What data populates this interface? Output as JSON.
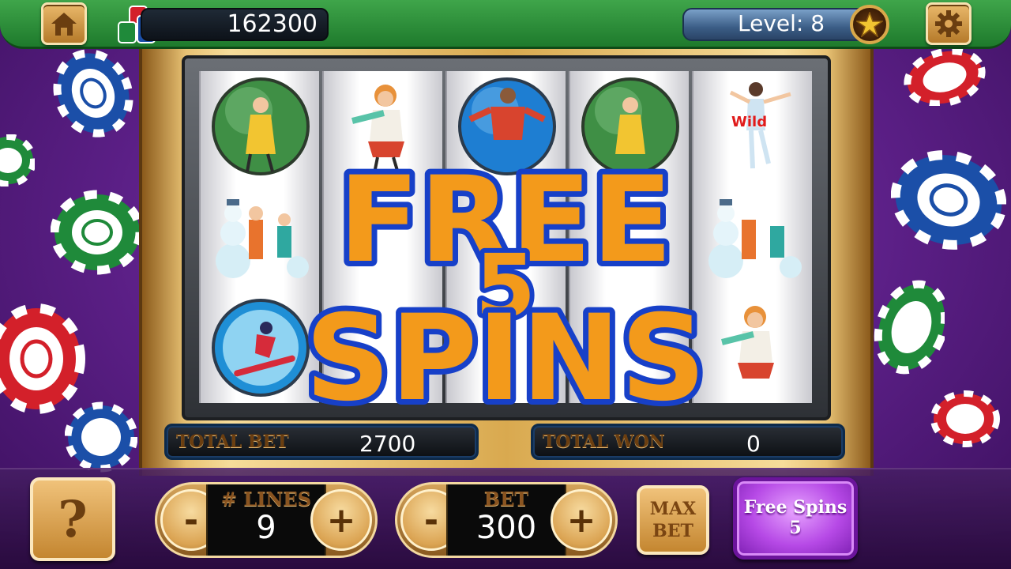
{
  "header": {
    "coins": "162300",
    "level_label": "Level: 8"
  },
  "reels": {
    "wild_label": "Wild"
  },
  "overlay": {
    "line1": "FREE",
    "count": "5",
    "line2": "SPINS"
  },
  "info": {
    "total_bet_label": "TOTAL BET",
    "total_bet_value": "2700",
    "total_won_label": "TOTAL WON",
    "total_won_value": "0"
  },
  "controls": {
    "help_label": "?",
    "lines_label": "# LINES",
    "lines_value": "9",
    "bet_label": "BET",
    "bet_value": "300",
    "minus": "-",
    "plus": "+",
    "max_bet_line1": "MAX",
    "max_bet_line2": "BET",
    "free_spins_label": "Free Spins",
    "free_spins_count": "5"
  },
  "colors": {
    "background": "#5b1f86",
    "topbar": "#2e8f3b",
    "gold": "#d9a94f",
    "free_spins_button": "#b649e6",
    "overlay_text": "#f39a1b",
    "overlay_outline": "#1740c8"
  },
  "icons": [
    "home-icon",
    "chips-icon",
    "star-icon",
    "gear-icon",
    "question-icon"
  ]
}
